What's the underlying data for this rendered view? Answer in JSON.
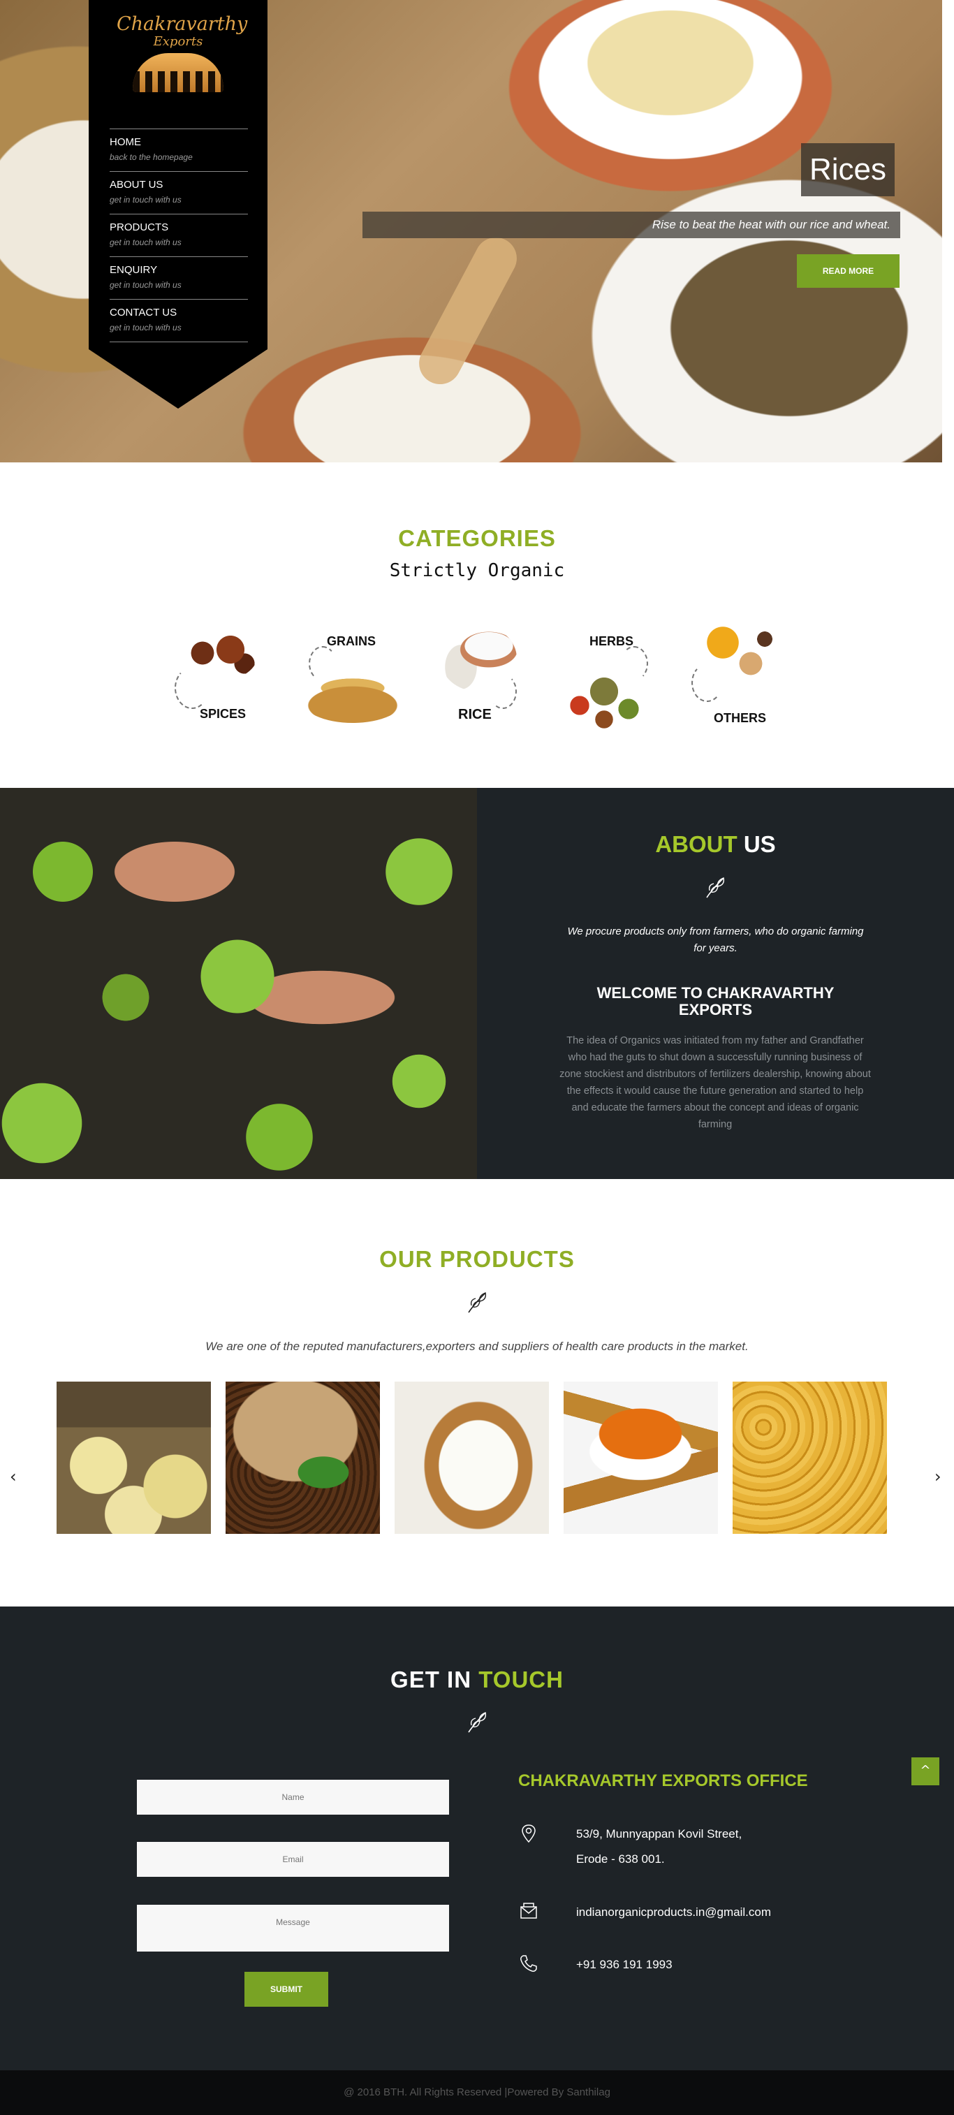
{
  "nav": {
    "logo_title": "Chakravarthy",
    "logo_sub": "Exports",
    "items": [
      {
        "label": "HOME",
        "sub": "back to the homepage"
      },
      {
        "label": "ABOUT US",
        "sub": "get in touch with us"
      },
      {
        "label": "PRODUCTS",
        "sub": "get in touch with us"
      },
      {
        "label": "ENQUIRY",
        "sub": "get in touch with us"
      },
      {
        "label": "CONTACT US",
        "sub": "get in touch with us"
      }
    ]
  },
  "slide": {
    "title": "Rices",
    "caption": "Rise to beat the heat with our rice and wheat.",
    "button": "READ MORE"
  },
  "categories": {
    "title": "CATEGORIES",
    "subtitle": "Strictly Organic",
    "items": [
      "SPICES",
      "GRAINS",
      "RICE",
      "HERBS",
      "OTHERS"
    ]
  },
  "about": {
    "title_part1": "ABOUT",
    "title_part2": "US",
    "quote": "We procure products only from farmers, who do organic farming for years.",
    "heading": "WELCOME TO CHAKRAVARTHY EXPORTS",
    "body": "The idea of Organics was initiated from my father and Grandfather who had the guts to shut down a successfully running business of zone stockiest and distributors of fertilizers dealership, knowing about the effects it would cause the future generation and started to help and educate the farmers about the concept and ideas of organic farming"
  },
  "products": {
    "title": "OUR PRODUCTS",
    "description": "We are one of the reputed manufacturers,exporters and suppliers of health care products in the market.",
    "prev": "‹",
    "next": "›"
  },
  "contact": {
    "title_part1": "GET IN",
    "title_part2": "TOUCH",
    "name_placeholder": "Name",
    "email_placeholder": "Email",
    "message_placeholder": "Message",
    "submit": "SUBMIT",
    "office_title": "CHAKRAVARTHY EXPORTS OFFICE",
    "address_line1": "53/9, Munnyappan Kovil Street,",
    "address_line2": "Erode - 638 001.",
    "email": "indianorganicproducts.in@gmail.com",
    "phone": "+91 936 191 1993",
    "to_top": "^"
  },
  "footer": {
    "text": "@ 2016 BTH. All Rights Reserved |Powered By Santhilag"
  },
  "colors": {
    "accent_green": "#79a324",
    "title_green": "#8fae25",
    "dark_bg": "#1e2327"
  }
}
